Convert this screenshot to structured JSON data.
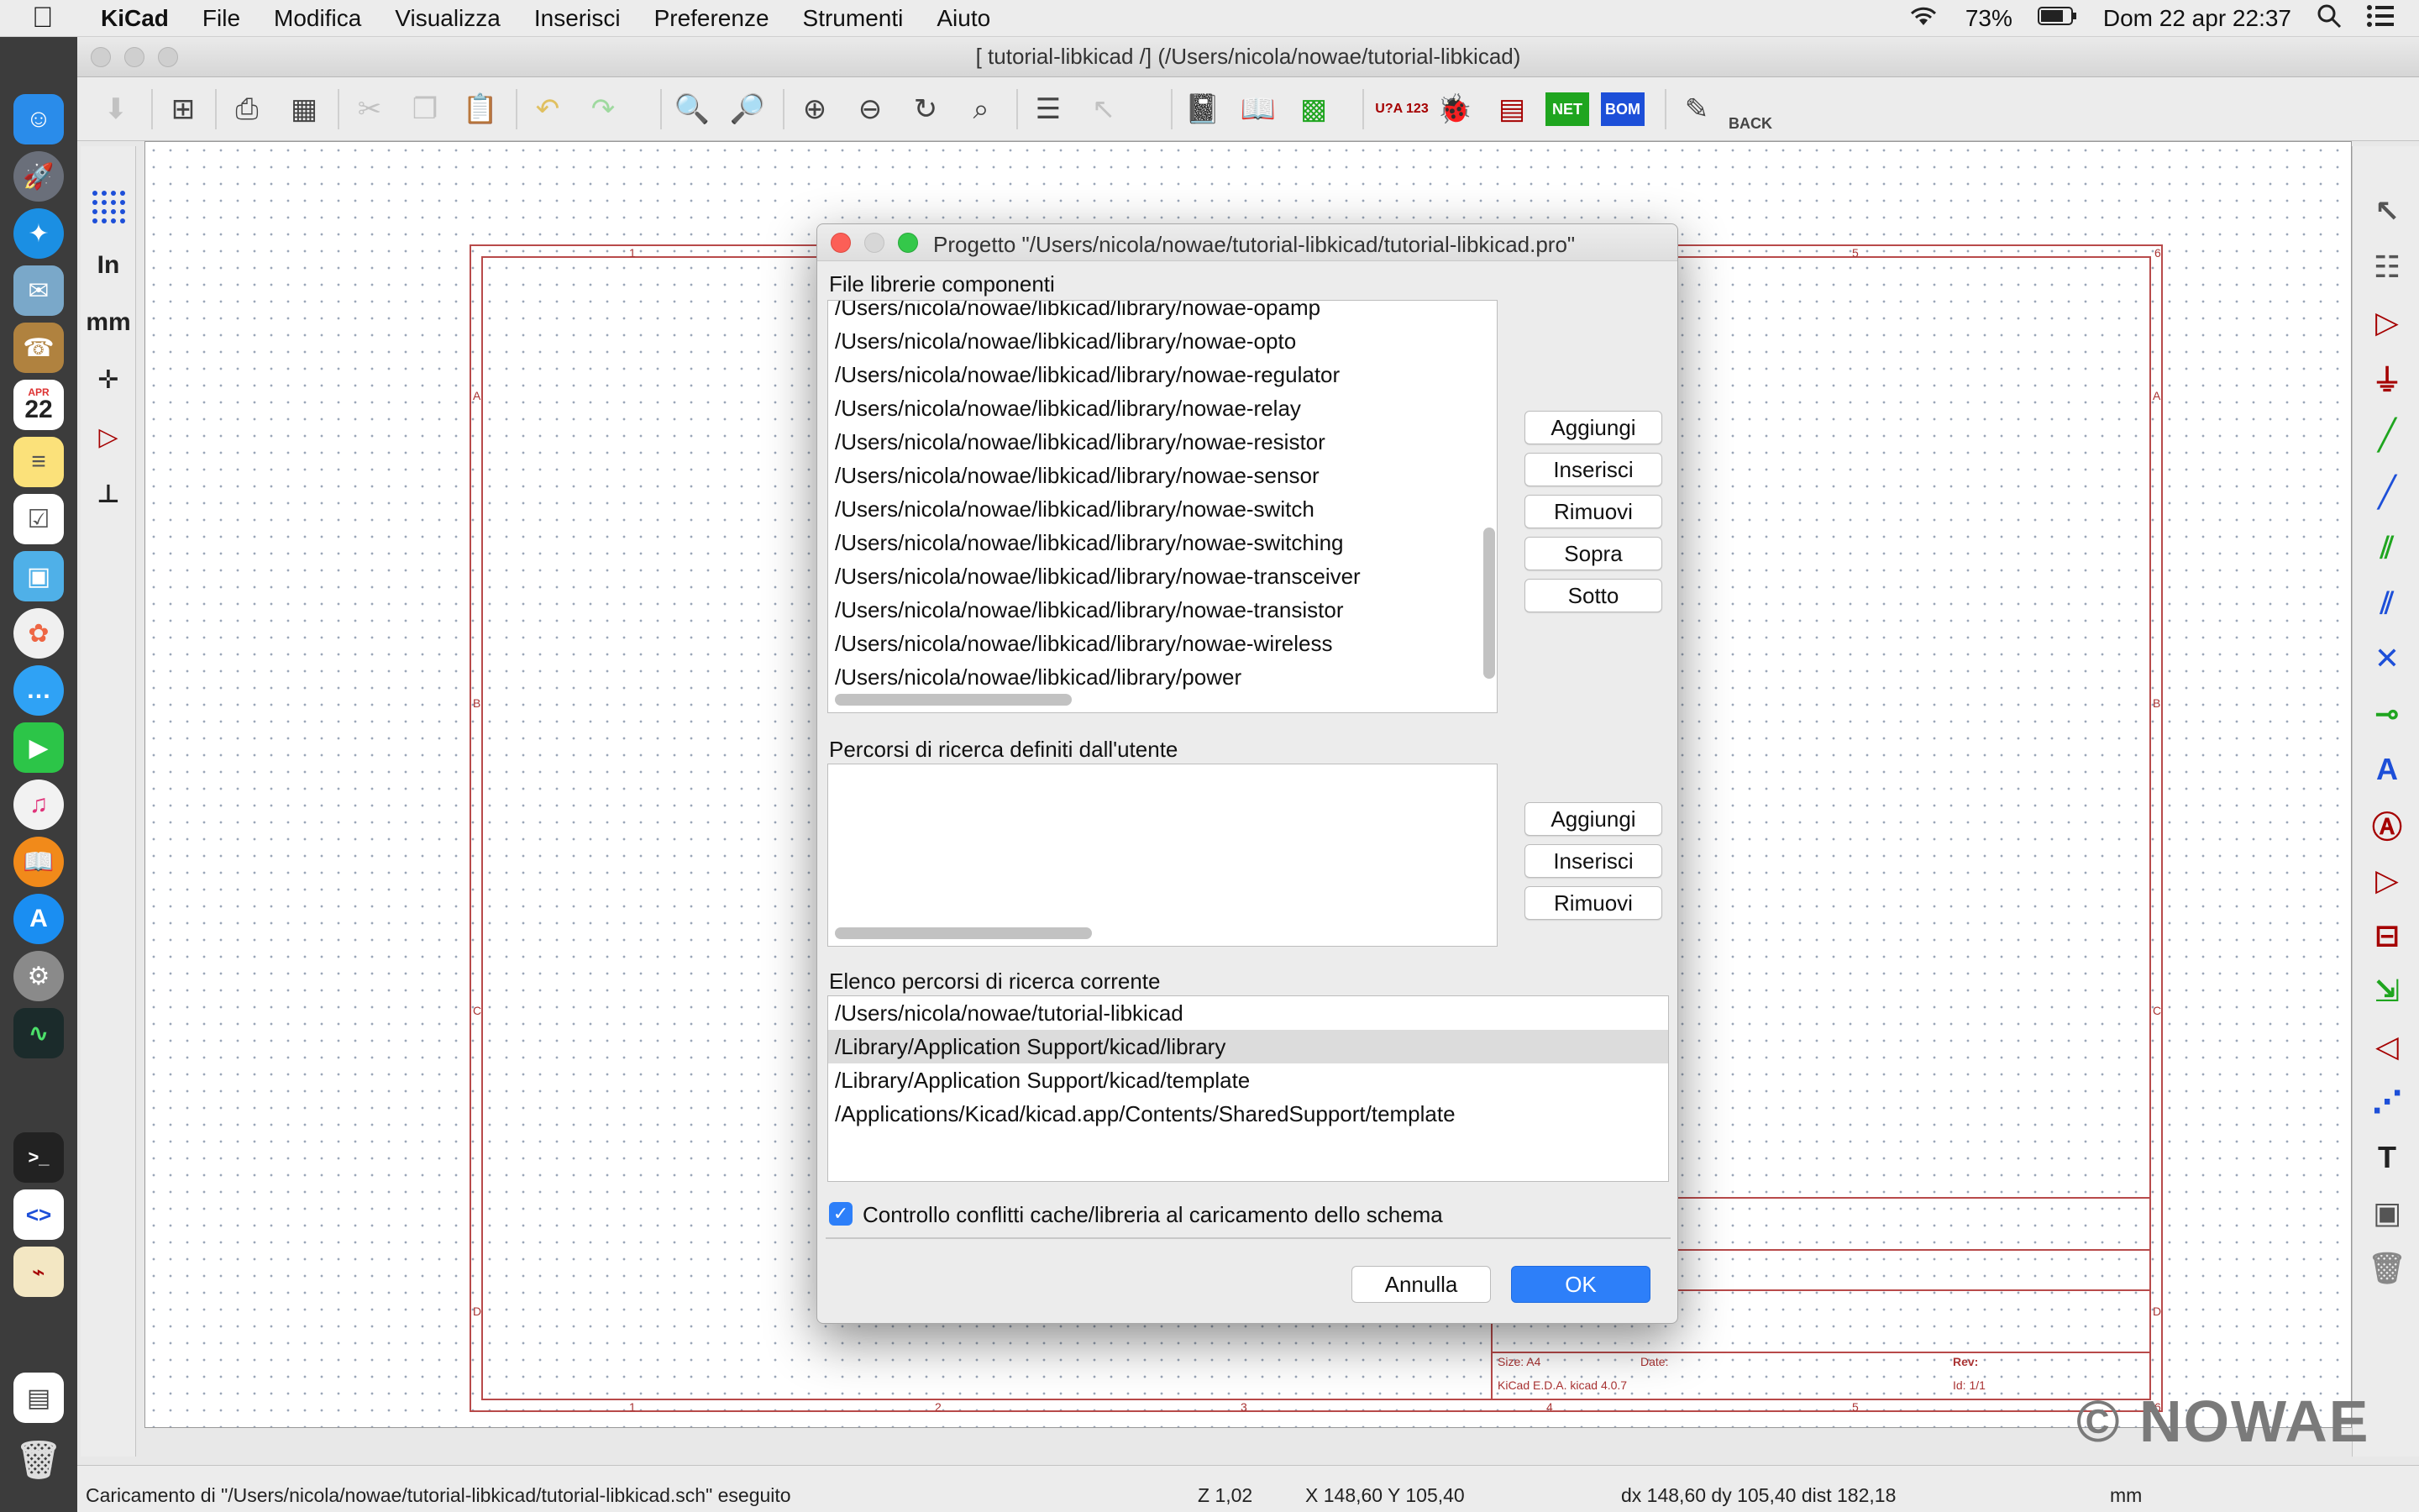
{
  "menubar": {
    "app_name": "KiCad",
    "menus": [
      "File",
      "Modifica",
      "Visualizza",
      "Inserisci",
      "Preferenze",
      "Strumenti",
      "Aiuto"
    ],
    "battery": "73%",
    "clock": "Dom 22 apr  22:37"
  },
  "dock": {
    "calendar_month": "APR",
    "calendar_day": "22"
  },
  "window": {
    "title": "[ tutorial-libkicad /] (/Users/nicola/nowae/tutorial-libkicad)"
  },
  "toolbar": {
    "annotate_label": "U?A 123",
    "netlist_label": "NET",
    "bom_label": "BOM",
    "back_label": "BACK"
  },
  "left_toolbar": {
    "inch_label": "In",
    "mm_label": "mm"
  },
  "sheet": {
    "col_labels": [
      "1",
      "2",
      "3",
      "4",
      "5",
      "6"
    ],
    "row_labels": [
      "A",
      "B",
      "C",
      "D"
    ],
    "size_text": "Size: A4",
    "date_text": "Date:",
    "kicad_text": "KiCad E.D.A.  kicad 4.0.7",
    "rev_text": "Rev:",
    "id_text": "Id: 1/1"
  },
  "watermark": "© NOWAE",
  "statusbar": {
    "message": "Caricamento di \"/Users/nicola/nowae/tutorial-libkicad/tutorial-libkicad.sch\" eseguito",
    "zoom": "Z 1,02",
    "coords": "X 148,60  Y 105,40",
    "delta": "dx 148,60  dy 105,40  dist 182,18",
    "units": "mm"
  },
  "dialog": {
    "title": "Progetto \"/Users/nicola/nowae/tutorial-libkicad/tutorial-libkicad.pro\"",
    "libs_section": {
      "label": "File librerie componenti",
      "items": [
        "/Users/nicola/nowae/libkicad/library/nowae-opamp",
        "/Users/nicola/nowae/libkicad/library/nowae-opto",
        "/Users/nicola/nowae/libkicad/library/nowae-regulator",
        "/Users/nicola/nowae/libkicad/library/nowae-relay",
        "/Users/nicola/nowae/libkicad/library/nowae-resistor",
        "/Users/nicola/nowae/libkicad/library/nowae-sensor",
        "/Users/nicola/nowae/libkicad/library/nowae-switch",
        "/Users/nicola/nowae/libkicad/library/nowae-switching",
        "/Users/nicola/nowae/libkicad/library/nowae-transceiver",
        "/Users/nicola/nowae/libkicad/library/nowae-transistor",
        "/Users/nicola/nowae/libkicad/library/nowae-wireless",
        "/Users/nicola/nowae/libkicad/library/power"
      ],
      "buttons": [
        "Aggiungi",
        "Inserisci",
        "Rimuovi",
        "Sopra",
        "Sotto"
      ]
    },
    "user_paths_section": {
      "label": "Percorsi di ricerca definiti dall'utente",
      "buttons": [
        "Aggiungi",
        "Inserisci",
        "Rimuovi"
      ]
    },
    "current_paths_section": {
      "label": "Elenco percorsi di ricerca corrente",
      "items": [
        "/Users/nicola/nowae/tutorial-libkicad",
        "/Library/Application Support/kicad/library",
        "/Library/Application Support/kicad/template",
        "/Applications/Kicad/kicad.app/Contents/SharedSupport/template"
      ],
      "selected_index": 1
    },
    "checkbox_label": "Controllo conflitti cache/libreria al caricamento dello schema",
    "checkbox_checked": true,
    "cancel_label": "Annulla",
    "ok_label": "OK"
  },
  "colors": {
    "sheet_border": "#b84a4a",
    "ok_button": "#2d7ff9",
    "schematic_tool": "#a50000",
    "wire_tool": "#1fa51f",
    "bus_tool": "#1d4fd8"
  }
}
